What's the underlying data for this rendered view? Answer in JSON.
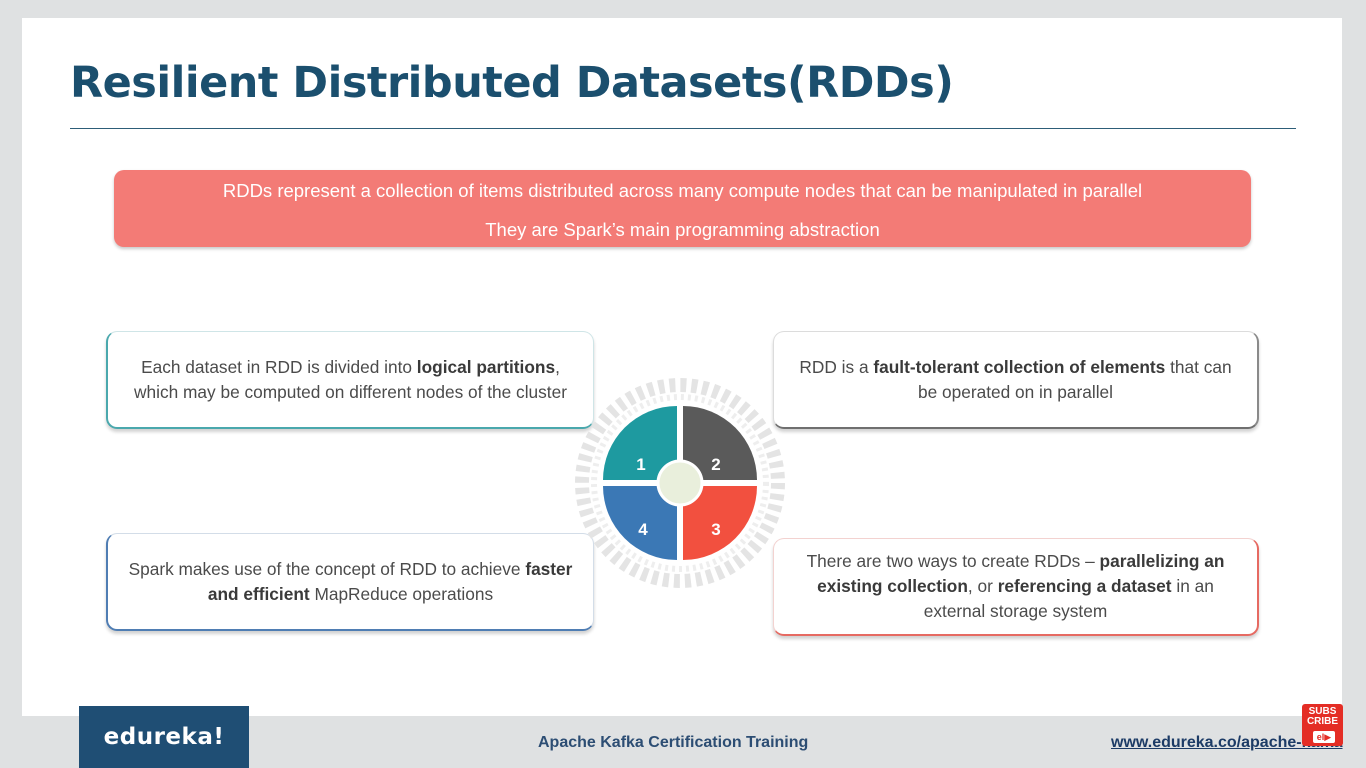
{
  "slide": {
    "title": "Resilient Distributed Datasets(RDDs)",
    "banner": {
      "line1": "RDDs represent a collection of items distributed across many compute nodes that can be manipulated in parallel",
      "line2": "They are Spark’s main programming abstraction",
      "color": "#f37b76"
    },
    "boxes": {
      "b1": {
        "pre": "Each dataset in RDD is divided into ",
        "bold": "logical partitions",
        "post": ", which may be computed on different nodes of the cluster"
      },
      "b2": {
        "pre": "RDD is a ",
        "bold": "fault-tolerant collection of elements",
        "post": " that can be operated on in parallel"
      },
      "b3": {
        "pre": "Spark makes use of the concept of RDD to achieve ",
        "bold": "faster and efficient",
        "post": " MapReduce operations"
      },
      "b4": {
        "pre": "There are two ways to create RDDs – ",
        "bold1": "parallelizing an existing collection",
        "mid": ", or ",
        "bold2": "referencing a dataset",
        "post": " in an external storage system"
      }
    },
    "quadrants": [
      {
        "label": "1",
        "color": "#1e9aa0"
      },
      {
        "label": "2",
        "color": "#5a5a5a"
      },
      {
        "label": "3",
        "color": "#f2503f"
      },
      {
        "label": "4",
        "color": "#3b78b5"
      }
    ]
  },
  "footer": {
    "logo": "edureka!",
    "course": "Apache Kafka Certification Training",
    "url": "www.edureka.co/apache-kafka",
    "subscribe_line1": "SUBS",
    "subscribe_line2": "CRIBE",
    "subscribe_play": "el▶"
  }
}
